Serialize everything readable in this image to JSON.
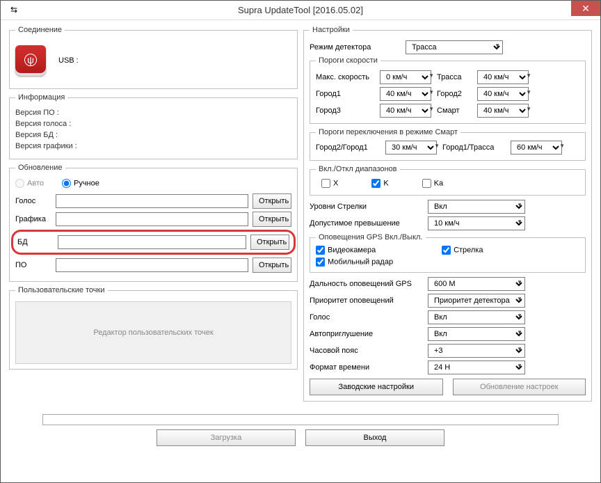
{
  "title": "Supra UpdateTool [2016.05.02]",
  "connection": {
    "legend": "Соединение",
    "usb_label": "USB :"
  },
  "info": {
    "legend": "Информация",
    "fw": "Версия ПО :",
    "voice": "Версия голоса :",
    "db": "Версия БД :",
    "gfx": "Версия графики :"
  },
  "update": {
    "legend": "Обновление",
    "auto": "Авто",
    "manual": "Ручное",
    "voice": "Голос",
    "gfx": "Графика",
    "db": "БД",
    "fw": "ПО",
    "open": "Открыть"
  },
  "userpoints": {
    "legend": "Пользовательские точки",
    "editor": "Редактор пользовательских точек"
  },
  "settings": {
    "legend": "Настройки",
    "mode_label": "Режим детектора",
    "mode_value": "Трасса",
    "speed": {
      "legend": "Пороги скорости",
      "max": "Макс. скорость",
      "max_v": "0 км/ч",
      "trassa": "Трасса",
      "trassa_v": "40 км/ч",
      "gorod1": "Город1",
      "gorod1_v": "40 км/ч",
      "gorod2": "Город2",
      "gorod2_v": "40 км/ч",
      "gorod3": "Город3",
      "gorod3_v": "40 км/ч",
      "smart": "Смарт",
      "smart_v": "40 км/ч"
    },
    "smart_thresh": {
      "legend": "Пороги переключения в режиме Смарт",
      "g2g1": "Город2/Город1",
      "g2g1_v": "30 км/ч",
      "g1t": "Город1/Трасса",
      "g1t_v": "60 км/ч"
    },
    "bands": {
      "legend": "Вкл./Откл диапазонов",
      "x": "X",
      "k": "K",
      "ka": "Ka"
    },
    "arrows": "Уровни Стрелки",
    "arrows_v": "Вкл",
    "allow": "Допустимое превышение",
    "allow_v": "10 км/ч",
    "gps": {
      "legend": "Оповещения GPS Вкл./Выкл.",
      "cam": "Видеокамера",
      "strelka": "Стрелка",
      "radar": "Мобильный радар"
    },
    "gps_dist": "Дальность оповещений GPS",
    "gps_dist_v": "600 M",
    "priority": "Приоритет оповещений",
    "priority_v": "Приоритет детектора",
    "voice": "Голос",
    "voice_v": "Вкл",
    "automute": "Автоприглушение",
    "automute_v": "Вкл",
    "tz": "Часовой пояс",
    "tz_v": "+3",
    "timefmt": "Формат времени",
    "timefmt_v": "24 H",
    "factory": "Заводские настройки",
    "update_set": "Обновление настроек"
  },
  "footer": {
    "load": "Загрузка",
    "exit": "Выход"
  }
}
